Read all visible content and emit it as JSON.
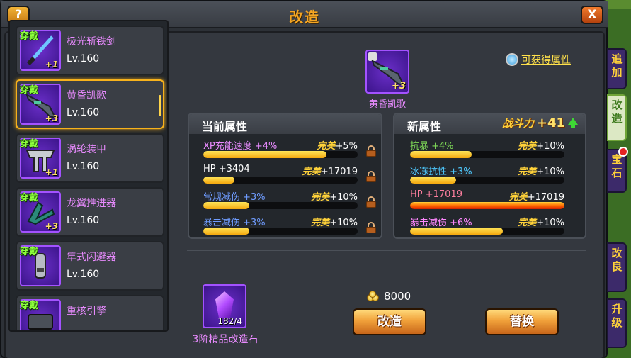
{
  "window": {
    "title": "改造",
    "help_label": "?",
    "close_label": "X"
  },
  "equipment_list": [
    {
      "badge": "穿戴",
      "name": "极光斩铁剑",
      "level": "Lv.160",
      "plus": "+1"
    },
    {
      "badge": "穿戴",
      "name": "黄昏凯歌",
      "level": "Lv.160",
      "plus": "+3",
      "selected": true
    },
    {
      "badge": "穿戴",
      "name": "涡轮装甲",
      "level": "Lv.160",
      "plus": "+1"
    },
    {
      "badge": "穿戴",
      "name": "龙翼推进器",
      "level": "Lv.160",
      "plus": "+3"
    },
    {
      "badge": "穿戴",
      "name": "隼式闪避器",
      "level": "Lv.160",
      "plus": ""
    },
    {
      "badge": "穿戴",
      "name": "重核引擎",
      "level": "",
      "plus": ""
    }
  ],
  "preview": {
    "name": "黄昏凯歌",
    "plus": "+3"
  },
  "obtainable_link": "可获得属性",
  "current_attributes": {
    "title": "当前属性",
    "rows": [
      {
        "name": "XP充能速度 +4%",
        "perfect_label": "完美",
        "perfect_value": "+5%",
        "fill": 0.8,
        "color": "#e98bff"
      },
      {
        "name": "HP +3404",
        "perfect_label": "完美",
        "perfect_value": "+17019",
        "fill": 0.2,
        "color": "#ffffff"
      },
      {
        "name": "常规减伤 +3%",
        "perfect_label": "完美",
        "perfect_value": "+10%",
        "fill": 0.3,
        "color": "#6f9cff"
      },
      {
        "name": "暴击减伤 +3%",
        "perfect_label": "完美",
        "perfect_value": "+10%",
        "fill": 0.3,
        "color": "#6f9cff"
      }
    ]
  },
  "new_attributes": {
    "title": "新属性",
    "power_label": "战斗力",
    "power_value": "+41",
    "rows": [
      {
        "name": "抗暴 +4%",
        "perfect_label": "完美",
        "perfect_value": "+10%",
        "fill": 0.4,
        "color": "#7ed957"
      },
      {
        "name": "冰冻抗性 +3%",
        "perfect_label": "完美",
        "perfect_value": "+10%",
        "fill": 0.3,
        "color": "#4ec9ff"
      },
      {
        "name": "HP +17019",
        "perfect_label": "完美",
        "perfect_value": "+17019",
        "fill": 1.0,
        "color": "#ff7f9f",
        "fire": true
      },
      {
        "name": "暴击减伤 +6%",
        "perfect_label": "完美",
        "perfect_value": "+10%",
        "fill": 0.6,
        "color": "#ff88ff"
      }
    ]
  },
  "material": {
    "name": "3阶精品改造石",
    "count": "182/4"
  },
  "cost": "8000",
  "buttons": {
    "remake": "改造",
    "replace": "替换"
  },
  "side_tabs": [
    {
      "label": "追加",
      "active": false
    },
    {
      "label": "改造",
      "active": true
    },
    {
      "label": "宝石",
      "active": false
    },
    {
      "label": "改良",
      "active": false
    },
    {
      "label": "升级",
      "active": false
    }
  ]
}
